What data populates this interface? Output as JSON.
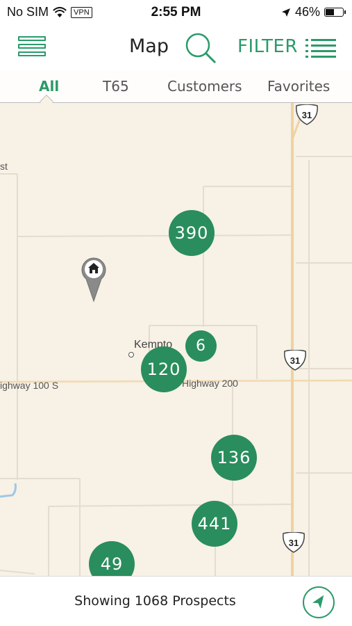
{
  "status_bar": {
    "carrier": "No SIM",
    "vpn": "VPN",
    "time": "2:55 PM",
    "battery": "46%"
  },
  "nav": {
    "title": "Map",
    "filter_label": "FILTER",
    "menu_icon": "hamburger-icon",
    "search_icon": "search-icon",
    "list_icon": "list-icon",
    "accent_color": "#2b9a6a"
  },
  "tabs": [
    {
      "label": "All",
      "active": true
    },
    {
      "label": "T65",
      "active": false
    },
    {
      "label": "Customers",
      "active": false
    },
    {
      "label": "Favorites",
      "active": false
    }
  ],
  "map": {
    "labels": {
      "kempton": "Kempto",
      "highway_100": "ighway 100 S",
      "highway_200": "Highway 200",
      "st": "st"
    },
    "route_shields": [
      "31",
      "31",
      "31"
    ],
    "clusters": [
      {
        "count": "390"
      },
      {
        "count": "6"
      },
      {
        "count": "120"
      },
      {
        "count": "136"
      },
      {
        "count": "441"
      },
      {
        "count": "49"
      }
    ],
    "cluster_color": "#2a8d5d",
    "home_pin_icon": "home-pin-icon"
  },
  "bottom_bar": {
    "summary": "Showing 1068 Prospects",
    "locate_icon": "location-arrow-icon"
  }
}
